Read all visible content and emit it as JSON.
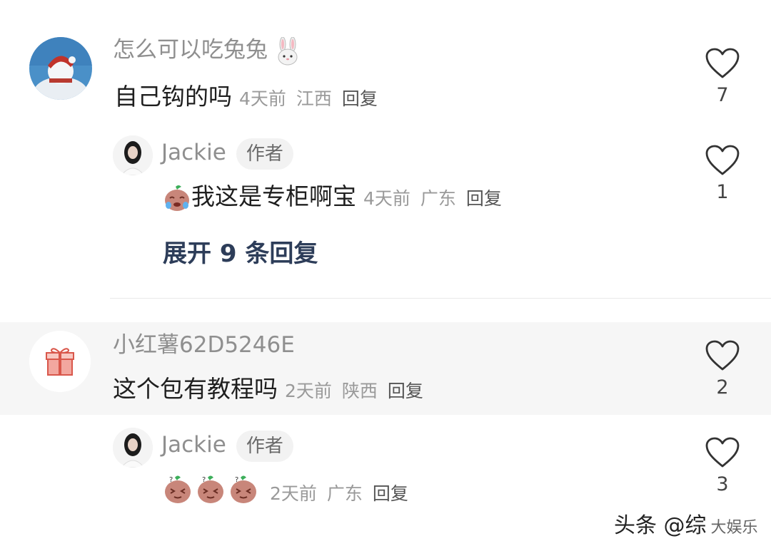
{
  "comments": [
    {
      "username": "怎么可以吃兔兔",
      "username_emoji": "rabbit",
      "text": "自己钩的吗",
      "time": "4天前",
      "location": "江西",
      "reply": "回复",
      "likes": "7",
      "reply_item": {
        "username": "Jackie",
        "badge": "作者",
        "emoji": "crying-sweet-potato",
        "text": "我这是专柜啊宝",
        "time": "4天前",
        "location": "广东",
        "reply": "回复",
        "likes": "1"
      },
      "expand": "展开 9 条回复"
    },
    {
      "username": "小红薯62D5246E",
      "avatar_icon": "gift-icon",
      "text": "这个包有教程吗",
      "time": "2天前",
      "location": "陕西",
      "reply": "回复",
      "likes": "2",
      "reply_item": {
        "username": "Jackie",
        "badge": "作者",
        "emoji": "sweet-potato-questioning",
        "time": "2天前",
        "location": "广东",
        "reply": "回复",
        "likes": "3"
      }
    }
  ],
  "watermark": {
    "text": "头条 @综",
    "suffix": "大娱乐"
  }
}
